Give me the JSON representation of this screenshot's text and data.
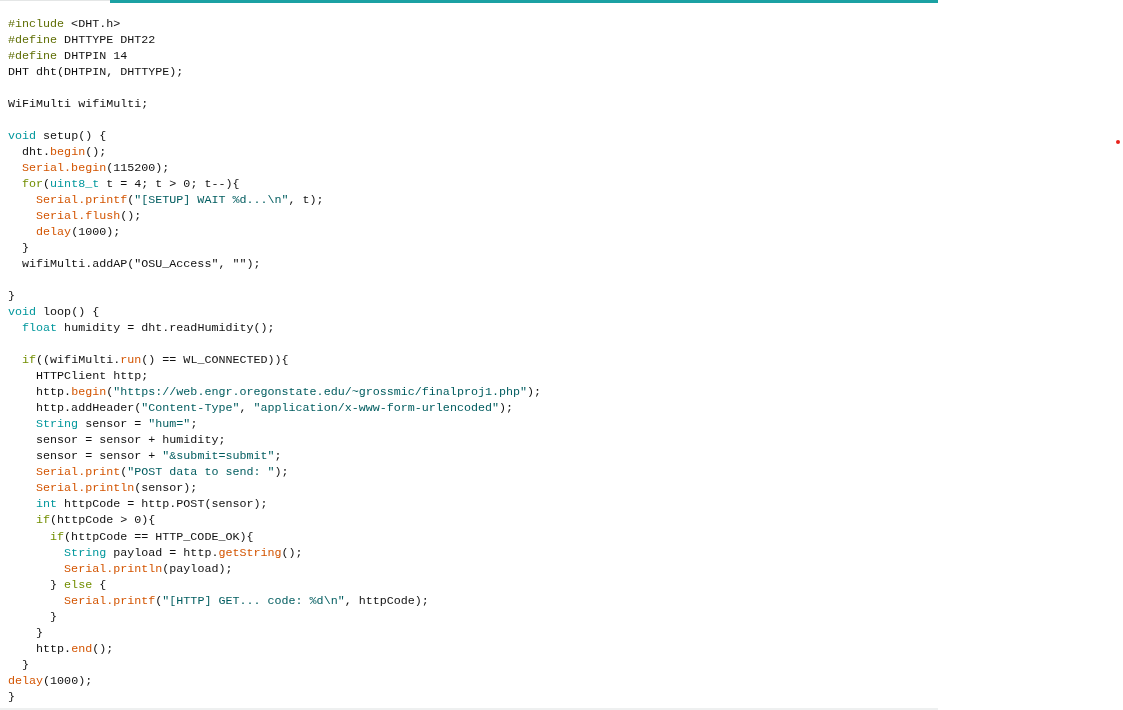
{
  "editor": {
    "lines": [
      {
        "kind": "code",
        "segments": [
          {
            "text": "#include",
            "kind": "directive"
          },
          {
            "text": " <DHT.h>",
            "kind": "plain"
          }
        ]
      },
      {
        "kind": "code",
        "segments": [
          {
            "text": "#define",
            "kind": "directive"
          },
          {
            "text": " DHTTYPE DHT22",
            "kind": "plain"
          }
        ]
      },
      {
        "kind": "code",
        "segments": [
          {
            "text": "#define",
            "kind": "directive"
          },
          {
            "text": " DHTPIN 14",
            "kind": "plain"
          }
        ]
      },
      {
        "kind": "code",
        "segments": [
          {
            "text": "DHT dht(DHTPIN, DHTTYPE);",
            "kind": "plain"
          }
        ]
      },
      {
        "kind": "blank"
      },
      {
        "kind": "code",
        "segments": [
          {
            "text": "WiFiMulti wifiMulti;",
            "kind": "plain"
          }
        ]
      },
      {
        "kind": "blank"
      },
      {
        "kind": "code",
        "segments": [
          {
            "text": "void",
            "kind": "type"
          },
          {
            "text": " setup() {",
            "kind": "plain"
          }
        ]
      },
      {
        "kind": "code",
        "segments": [
          {
            "text": "  dht.",
            "kind": "plain"
          },
          {
            "text": "begin",
            "kind": "function"
          },
          {
            "text": "();",
            "kind": "plain"
          }
        ]
      },
      {
        "kind": "code",
        "segments": [
          {
            "text": "  Serial.begin",
            "kind": "function"
          },
          {
            "text": "(115200);",
            "kind": "plain"
          }
        ]
      },
      {
        "kind": "code",
        "segments": [
          {
            "text": "  for",
            "kind": "control"
          },
          {
            "text": "(",
            "kind": "plain"
          },
          {
            "text": "uint8_t",
            "kind": "type"
          },
          {
            "text": " t = 4; t > 0; t--){",
            "kind": "plain"
          }
        ]
      },
      {
        "kind": "code",
        "segments": [
          {
            "text": "    Serial.printf",
            "kind": "function"
          },
          {
            "text": "(",
            "kind": "plain"
          },
          {
            "text": "\"[SETUP] WAIT %d...\\n\"",
            "kind": "string"
          },
          {
            "text": ", t);",
            "kind": "plain"
          }
        ]
      },
      {
        "kind": "code",
        "segments": [
          {
            "text": "    Serial.flush",
            "kind": "function"
          },
          {
            "text": "();",
            "kind": "plain"
          }
        ]
      },
      {
        "kind": "code",
        "segments": [
          {
            "text": "    delay",
            "kind": "function"
          },
          {
            "text": "(1000);",
            "kind": "plain"
          }
        ]
      },
      {
        "kind": "code",
        "segments": [
          {
            "text": "  }",
            "kind": "plain"
          }
        ]
      },
      {
        "kind": "code",
        "segments": [
          {
            "text": "  wifiMulti.addAP(\"OSU_Access\", \"\");",
            "kind": "plain"
          }
        ]
      },
      {
        "kind": "blank"
      },
      {
        "kind": "code",
        "segments": [
          {
            "text": "}",
            "kind": "plain"
          }
        ]
      },
      {
        "kind": "code",
        "segments": [
          {
            "text": "void",
            "kind": "type"
          },
          {
            "text": " loop() {",
            "kind": "plain"
          }
        ]
      },
      {
        "kind": "code",
        "segments": [
          {
            "text": "  float",
            "kind": "type"
          },
          {
            "text": " humidity = dht.readHumidity();",
            "kind": "plain"
          }
        ]
      },
      {
        "kind": "blank"
      },
      {
        "kind": "code",
        "segments": [
          {
            "text": "  if",
            "kind": "control"
          },
          {
            "text": "((wifiMulti.",
            "kind": "plain"
          },
          {
            "text": "run",
            "kind": "function"
          },
          {
            "text": "() == WL_CONNECTED)){",
            "kind": "plain"
          }
        ]
      },
      {
        "kind": "code",
        "segments": [
          {
            "text": "    HTTPClient http;",
            "kind": "plain"
          }
        ]
      },
      {
        "kind": "code",
        "segments": [
          {
            "text": "    http.",
            "kind": "plain"
          },
          {
            "text": "begin",
            "kind": "function"
          },
          {
            "text": "(",
            "kind": "plain"
          },
          {
            "text": "\"https://web.engr.oregonstate.edu/~grossmic/finalproj1.php\"",
            "kind": "string"
          },
          {
            "text": ");",
            "kind": "plain"
          }
        ]
      },
      {
        "kind": "code",
        "segments": [
          {
            "text": "    http.addHeader(",
            "kind": "plain"
          },
          {
            "text": "\"Content-Type\"",
            "kind": "string"
          },
          {
            "text": ", ",
            "kind": "plain"
          },
          {
            "text": "\"application/x-www-form-urlencoded\"",
            "kind": "string"
          },
          {
            "text": ");",
            "kind": "plain"
          }
        ]
      },
      {
        "kind": "code",
        "segments": [
          {
            "text": "    String",
            "kind": "type"
          },
          {
            "text": " sensor = ",
            "kind": "plain"
          },
          {
            "text": "\"hum=\"",
            "kind": "string"
          },
          {
            "text": ";",
            "kind": "plain"
          }
        ]
      },
      {
        "kind": "code",
        "segments": [
          {
            "text": "    sensor = sensor + humidity;",
            "kind": "plain"
          }
        ]
      },
      {
        "kind": "code",
        "segments": [
          {
            "text": "    sensor = sensor + ",
            "kind": "plain"
          },
          {
            "text": "\"&submit=submit\"",
            "kind": "string"
          },
          {
            "text": ";",
            "kind": "plain"
          }
        ]
      },
      {
        "kind": "code",
        "segments": [
          {
            "text": "    Serial.print",
            "kind": "function"
          },
          {
            "text": "(",
            "kind": "plain"
          },
          {
            "text": "\"POST data to send: \"",
            "kind": "string"
          },
          {
            "text": ");",
            "kind": "plain"
          }
        ]
      },
      {
        "kind": "code",
        "segments": [
          {
            "text": "    Serial.println",
            "kind": "function"
          },
          {
            "text": "(sensor);",
            "kind": "plain"
          }
        ]
      },
      {
        "kind": "code",
        "segments": [
          {
            "text": "    int",
            "kind": "type"
          },
          {
            "text": " httpCode = http.POST(sensor);",
            "kind": "plain"
          }
        ]
      },
      {
        "kind": "code",
        "segments": [
          {
            "text": "    if",
            "kind": "control"
          },
          {
            "text": "(httpCode > 0){",
            "kind": "plain"
          }
        ]
      },
      {
        "kind": "code",
        "segments": [
          {
            "text": "      if",
            "kind": "control"
          },
          {
            "text": "(httpCode == HTTP_CODE_OK){",
            "kind": "plain"
          }
        ]
      },
      {
        "kind": "code",
        "segments": [
          {
            "text": "        String",
            "kind": "type"
          },
          {
            "text": " payload = http.",
            "kind": "plain"
          },
          {
            "text": "getString",
            "kind": "function"
          },
          {
            "text": "();",
            "kind": "plain"
          }
        ]
      },
      {
        "kind": "code",
        "segments": [
          {
            "text": "        Serial.println",
            "kind": "function"
          },
          {
            "text": "(payload);",
            "kind": "plain"
          }
        ]
      },
      {
        "kind": "code",
        "segments": [
          {
            "text": "      } ",
            "kind": "plain"
          },
          {
            "text": "else",
            "kind": "control"
          },
          {
            "text": " {",
            "kind": "plain"
          }
        ]
      },
      {
        "kind": "code",
        "segments": [
          {
            "text": "        Serial.printf",
            "kind": "function"
          },
          {
            "text": "(",
            "kind": "plain"
          },
          {
            "text": "\"[HTTP] GET... code: %d\\n\"",
            "kind": "string"
          },
          {
            "text": ", httpCode);",
            "kind": "plain"
          }
        ]
      },
      {
        "kind": "code",
        "segments": [
          {
            "text": "      }",
            "kind": "plain"
          }
        ]
      },
      {
        "kind": "code",
        "segments": [
          {
            "text": "    }",
            "kind": "plain"
          }
        ]
      },
      {
        "kind": "code",
        "segments": [
          {
            "text": "    http.",
            "kind": "plain"
          },
          {
            "text": "end",
            "kind": "function"
          },
          {
            "text": "();",
            "kind": "plain"
          }
        ]
      },
      {
        "kind": "code",
        "segments": [
          {
            "text": "  }",
            "kind": "plain"
          }
        ]
      },
      {
        "kind": "code",
        "segments": [
          {
            "text": "delay",
            "kind": "function"
          },
          {
            "text": "(1000);",
            "kind": "plain"
          }
        ]
      },
      {
        "kind": "code",
        "segments": [
          {
            "text": "}",
            "kind": "plain"
          }
        ]
      }
    ]
  }
}
